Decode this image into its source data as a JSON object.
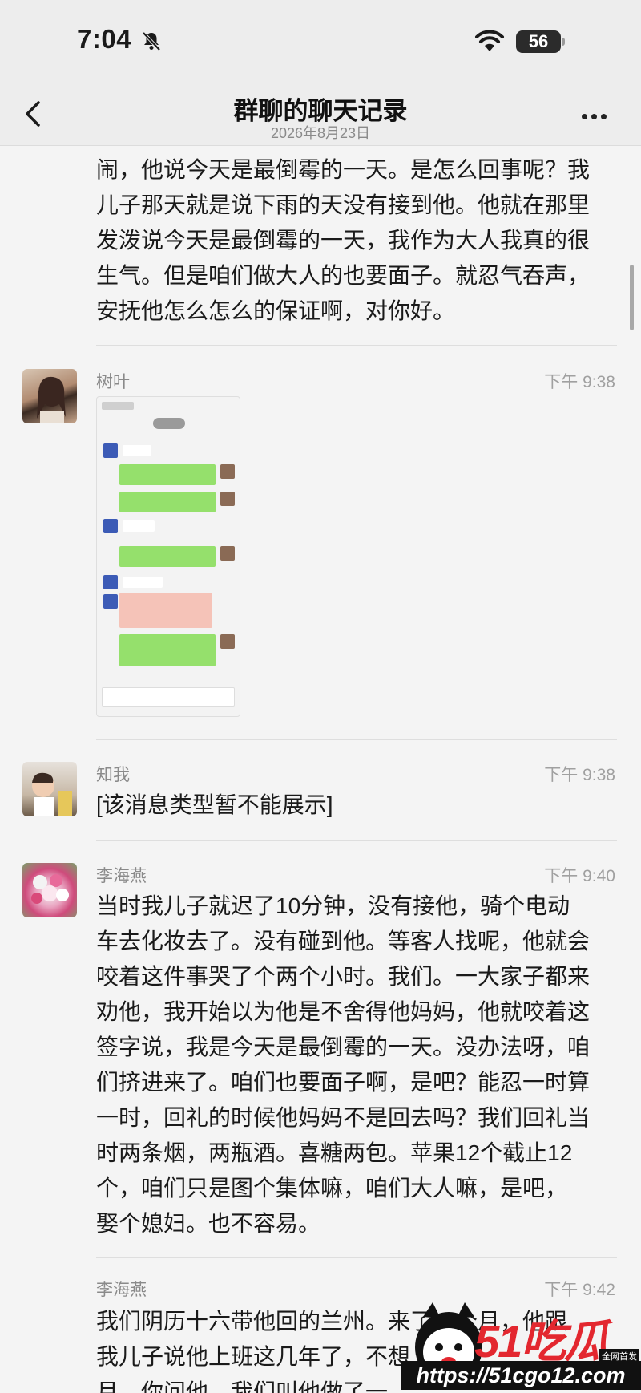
{
  "status": {
    "time": "7:04",
    "battery": "56"
  },
  "nav": {
    "title": "群聊的聊天记录",
    "subtitle": "2026年8月23日"
  },
  "messages": [
    {
      "id": "m0",
      "lines": [
        "闹，他说今天是最倒霉的一天。是怎么回事呢？我",
        "儿子那天就是说下雨的天没有接到他。他就在那里",
        "发泼说今天是最倒霉的一天，我作为大人我真的很",
        "生气。但是咱们做大人的也要面子。就忍气吞声，",
        "安抚他怎么怎么的保证啊，对你好。"
      ]
    },
    {
      "id": "m1",
      "sender": "树叶",
      "time": "下午 9:38",
      "type": "image"
    },
    {
      "id": "m2",
      "sender": "知我",
      "time": "下午 9:38",
      "lines": [
        "[该消息类型暂不能展示]"
      ]
    },
    {
      "id": "m3",
      "sender": "李海燕",
      "time": "下午 9:40",
      "lines": [
        "当时我儿子就迟了10分钟，没有接他，骑个电动",
        "车去化妆去了。没有碰到他。等客人找呢，他就会",
        "咬着这件事哭了个两个小时。我们。一大家子都来",
        "劝他，我开始以为他是不舍得他妈妈，他就咬着这",
        "签字说，我是今天是最倒霉的一天。没办法呀，咱",
        "们挤进来了。咱们也要面子啊，是吧？能忍一时算",
        "一时，回礼的时候他妈妈不是回去吗？我们回礼当",
        "时两条烟，两瓶酒。喜糖两包。苹果12个截止12",
        "个，咱们只是图个集体嘛，咱们大人嘛，是吧，",
        "娶个媳妇。也不容易。"
      ]
    },
    {
      "id": "m4",
      "sender": "李海燕",
      "time": "下午 9:42",
      "lines": [
        "我们阴历十六带他回的兰州。来了一个月，他跟",
        "我儿子说他上班这几年了，不想",
        "月，你问他，我们叫他做了一"
      ]
    }
  ],
  "watermark": {
    "brand": "51吃瓜",
    "url": "https://51cgo12.com",
    "tag": "全网首发"
  }
}
